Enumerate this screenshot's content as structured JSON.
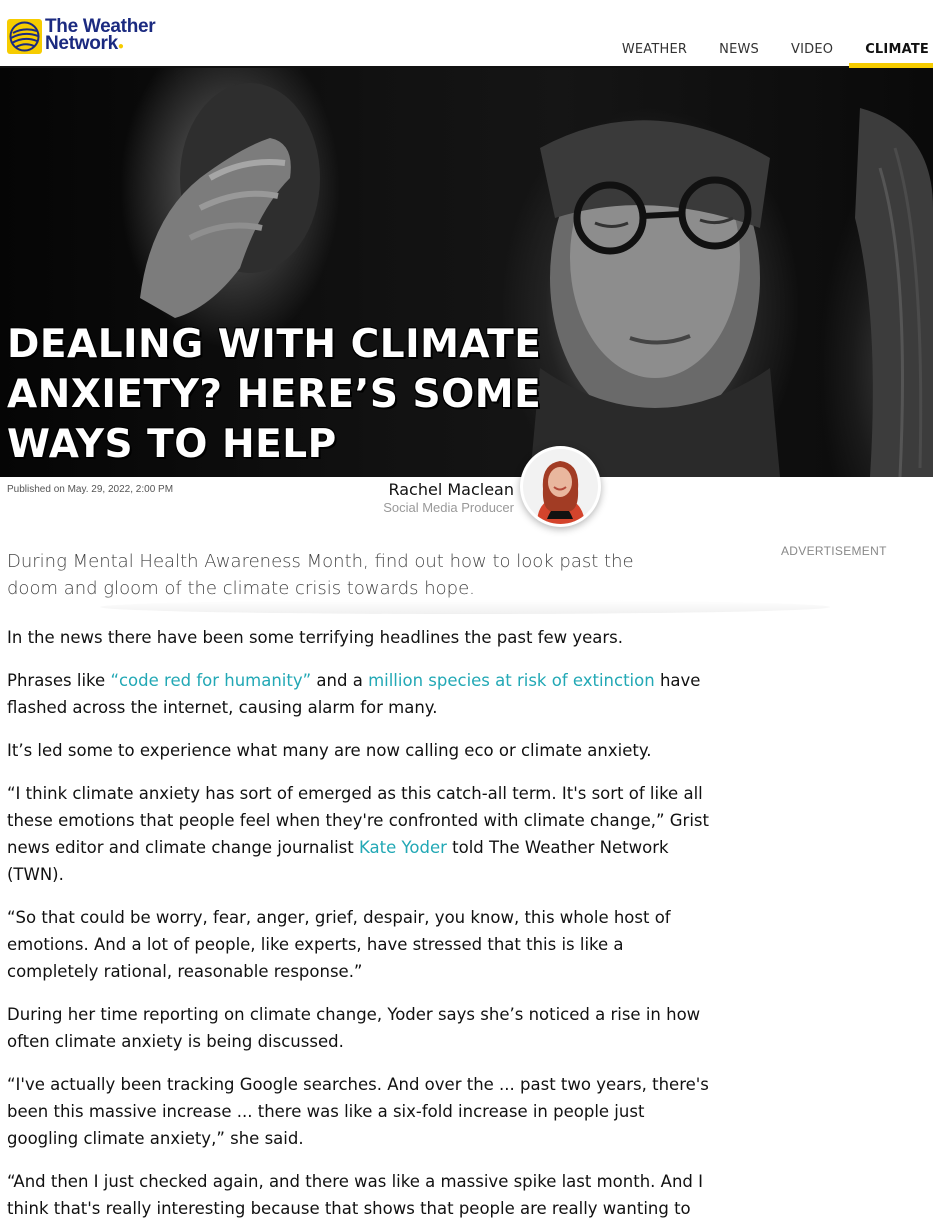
{
  "header": {
    "logo_line1": "The Weather",
    "logo_line2": "Network",
    "nav": [
      {
        "label": "WEATHER"
      },
      {
        "label": "NEWS"
      },
      {
        "label": "VIDEO"
      },
      {
        "label": "CLIMATE",
        "active": true
      }
    ]
  },
  "hero": {
    "title": "DEALING WITH CLIMATE ANXIETY? HERE’S SOME WAYS TO HELP"
  },
  "byline": {
    "published": "Published on May. 29, 2022, 2:00 PM",
    "author_name": "Rachel Maclean",
    "author_role": "Social Media Producer"
  },
  "summary": "During Mental Health Awareness Month, find out how to look past the doom and gloom of the climate crisis towards hope.",
  "advertisement_label": "ADVERTISEMENT",
  "article": {
    "p1": "In the news there have been some terrifying headlines the past few years.",
    "p2": {
      "before": "Phrases like ",
      "link1": "“code red for humanity”",
      "middle": " and a ",
      "link2": "million species at risk of extinction",
      "after": " have flashed across the internet, causing alarm for many."
    },
    "p3": "It’s led some to experience what many are now calling eco or climate anxiety.",
    "p4": {
      "before": "“I think climate anxiety has sort of emerged as this catch-all term. It's sort of like all these emotions that people feel when they're confronted with climate change,” Grist news editor and climate change journalist ",
      "link": "Kate Yoder",
      "after": " told The Weather Network (TWN)."
    },
    "p5": "“So that could be worry, fear, anger, grief, despair, you know, this whole host of emotions. And a lot of people, like experts, have stressed that this is like a completely rational, reasonable response.”",
    "p6": "During her time reporting on climate change, Yoder says she’s noticed a rise in how often climate anxiety is being discussed.",
    "p7": "“I've actually been tracking Google searches. And over the ... past two years, there's been this massive increase ... there was like a six-fold increase in people just googling climate anxiety,” she said.",
    "p8": "“And then I just checked again, and there was like a massive spike last month. And I think that's really interesting because that shows that people are really wanting to"
  },
  "colors": {
    "brand_yellow": "#f6cc00",
    "brand_navy": "#1b2a80",
    "link": "#22a8b5"
  }
}
